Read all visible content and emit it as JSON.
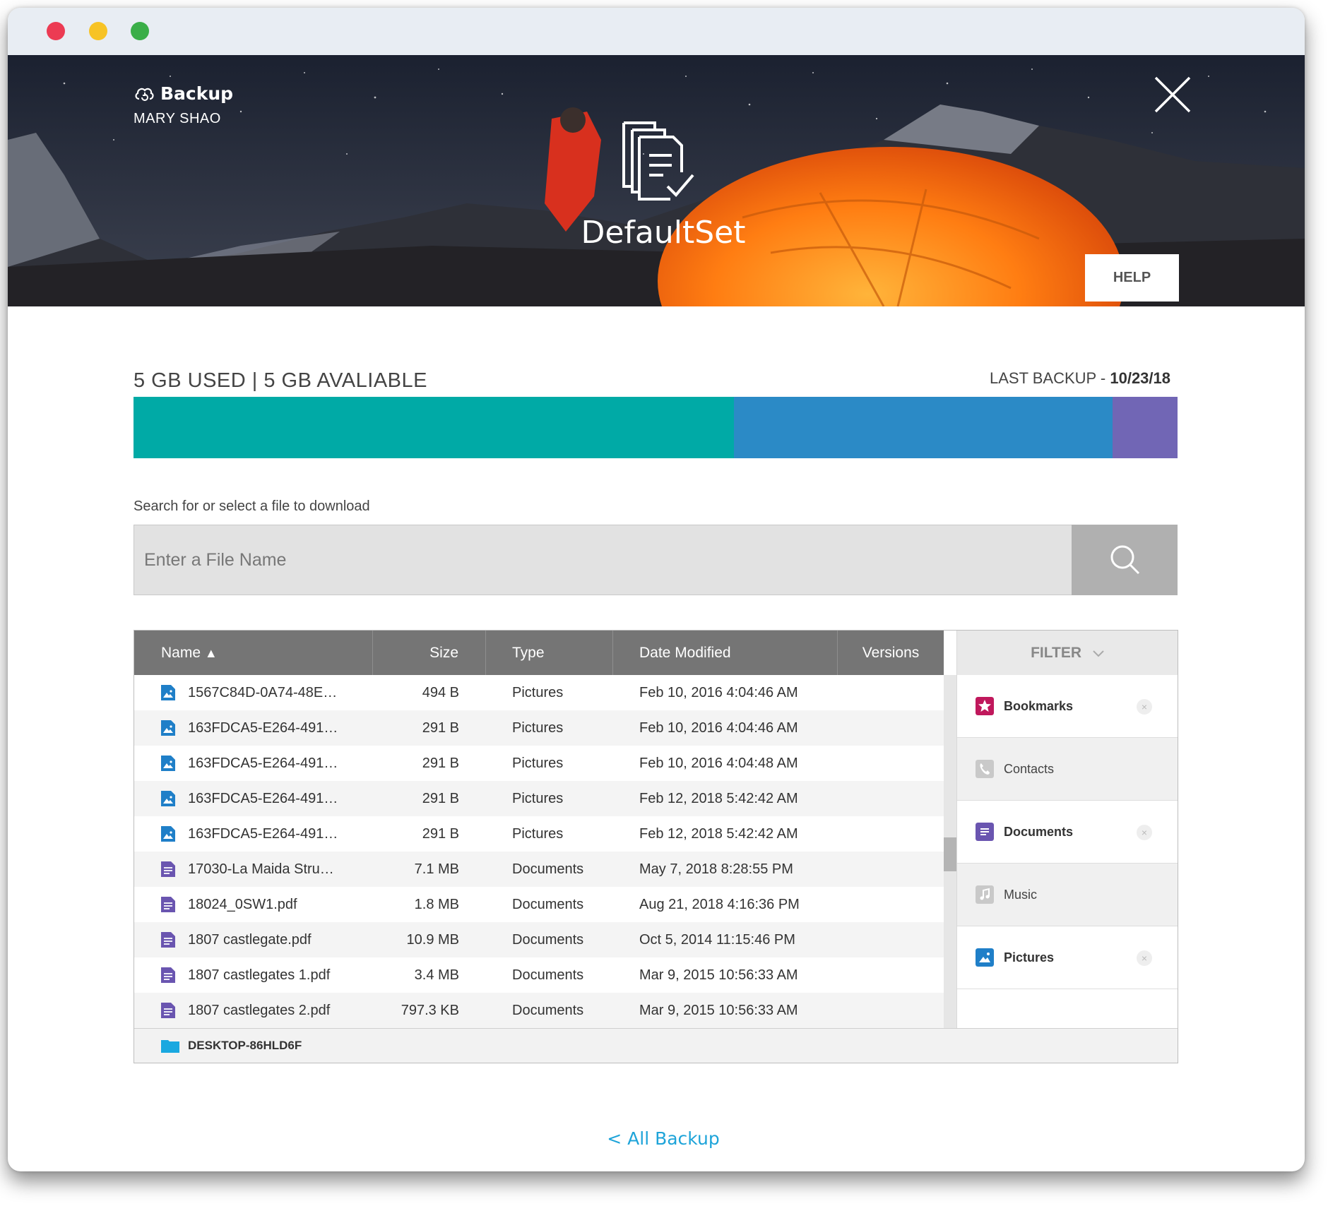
{
  "header": {
    "app_title": "Backup",
    "user_name": "MARY SHAO",
    "set_name": "DefaultSet",
    "help_label": "HELP"
  },
  "usage": {
    "label": "5 GB USED | 5 GB AVALIABLE",
    "last_backup_label": "LAST BACKUP - ",
    "last_backup_date": "10/23/18",
    "segments": [
      {
        "fraction": 0.575,
        "color": "#00aaa6"
      },
      {
        "fraction": 0.363,
        "color": "#2b8ac6"
      },
      {
        "fraction": 0.062,
        "color": "#7166b5"
      }
    ]
  },
  "search": {
    "label": "Search for or select a file to download",
    "placeholder": "Enter a File Name"
  },
  "table": {
    "columns": {
      "name": "Name",
      "size": "Size",
      "type": "Type",
      "date": "Date Modified",
      "versions": "Versions"
    },
    "rows": [
      {
        "name": "1567C84D-0A74-48E…",
        "size": "494 B",
        "type": "Pictures",
        "date": "Feb 10, 2016 4:04:46 AM",
        "versions": ""
      },
      {
        "name": "163FDCA5-E264-491…",
        "size": "291 B",
        "type": "Pictures",
        "date": "Feb 10, 2016 4:04:46 AM",
        "versions": ""
      },
      {
        "name": "163FDCA5-E264-491…",
        "size": "291 B",
        "type": "Pictures",
        "date": "Feb 10, 2016 4:04:48 AM",
        "versions": ""
      },
      {
        "name": "163FDCA5-E264-491…",
        "size": "291 B",
        "type": "Pictures",
        "date": "Feb 12, 2018 5:42:42 AM",
        "versions": ""
      },
      {
        "name": "163FDCA5-E264-491…",
        "size": "291 B",
        "type": "Pictures",
        "date": "Feb 12, 2018 5:42:42 AM",
        "versions": ""
      },
      {
        "name": "17030-La Maida Stru…",
        "size": "7.1 MB",
        "type": "Documents",
        "date": "May 7, 2018 8:28:55 PM",
        "versions": ""
      },
      {
        "name": "18024_0SW1.pdf",
        "size": "1.8 MB",
        "type": "Documents",
        "date": "Aug 21, 2018 4:16:36 PM",
        "versions": ""
      },
      {
        "name": "1807 castlegate.pdf",
        "size": "10.9 MB",
        "type": "Documents",
        "date": "Oct 5, 2014 11:15:46 PM",
        "versions": ""
      },
      {
        "name": "1807 castlegates 1.pdf",
        "size": "3.4 MB",
        "type": "Documents",
        "date": "Mar 9, 2015 10:56:33 AM",
        "versions": ""
      },
      {
        "name": "1807 castlegates 2.pdf",
        "size": "797.3 KB",
        "type": "Documents",
        "date": "Mar 9, 2015 10:56:33 AM",
        "versions": ""
      }
    ],
    "folder": "DESKTOP-86HLD6F"
  },
  "filter": {
    "label": "FILTER",
    "items": [
      {
        "label": "Bookmarks",
        "active": true,
        "icon": "star-icon",
        "color": "#c0185c"
      },
      {
        "label": "Contacts",
        "active": false,
        "icon": "phone-icon",
        "color": "#c9c9c9"
      },
      {
        "label": "Documents",
        "active": true,
        "icon": "document-icon",
        "color": "#6a55b0"
      },
      {
        "label": "Music",
        "active": false,
        "icon": "music-icon",
        "color": "#c9c9c9"
      },
      {
        "label": "Pictures",
        "active": true,
        "icon": "picture-icon",
        "color": "#1f7fc8"
      }
    ]
  },
  "footer": {
    "back_link": "< All Backup"
  },
  "colors": {
    "accent": "#1ea4d9",
    "picture_icon": "#1f7fc8",
    "document_icon": "#6a55b0",
    "folder_icon": "#1aa8e0"
  }
}
